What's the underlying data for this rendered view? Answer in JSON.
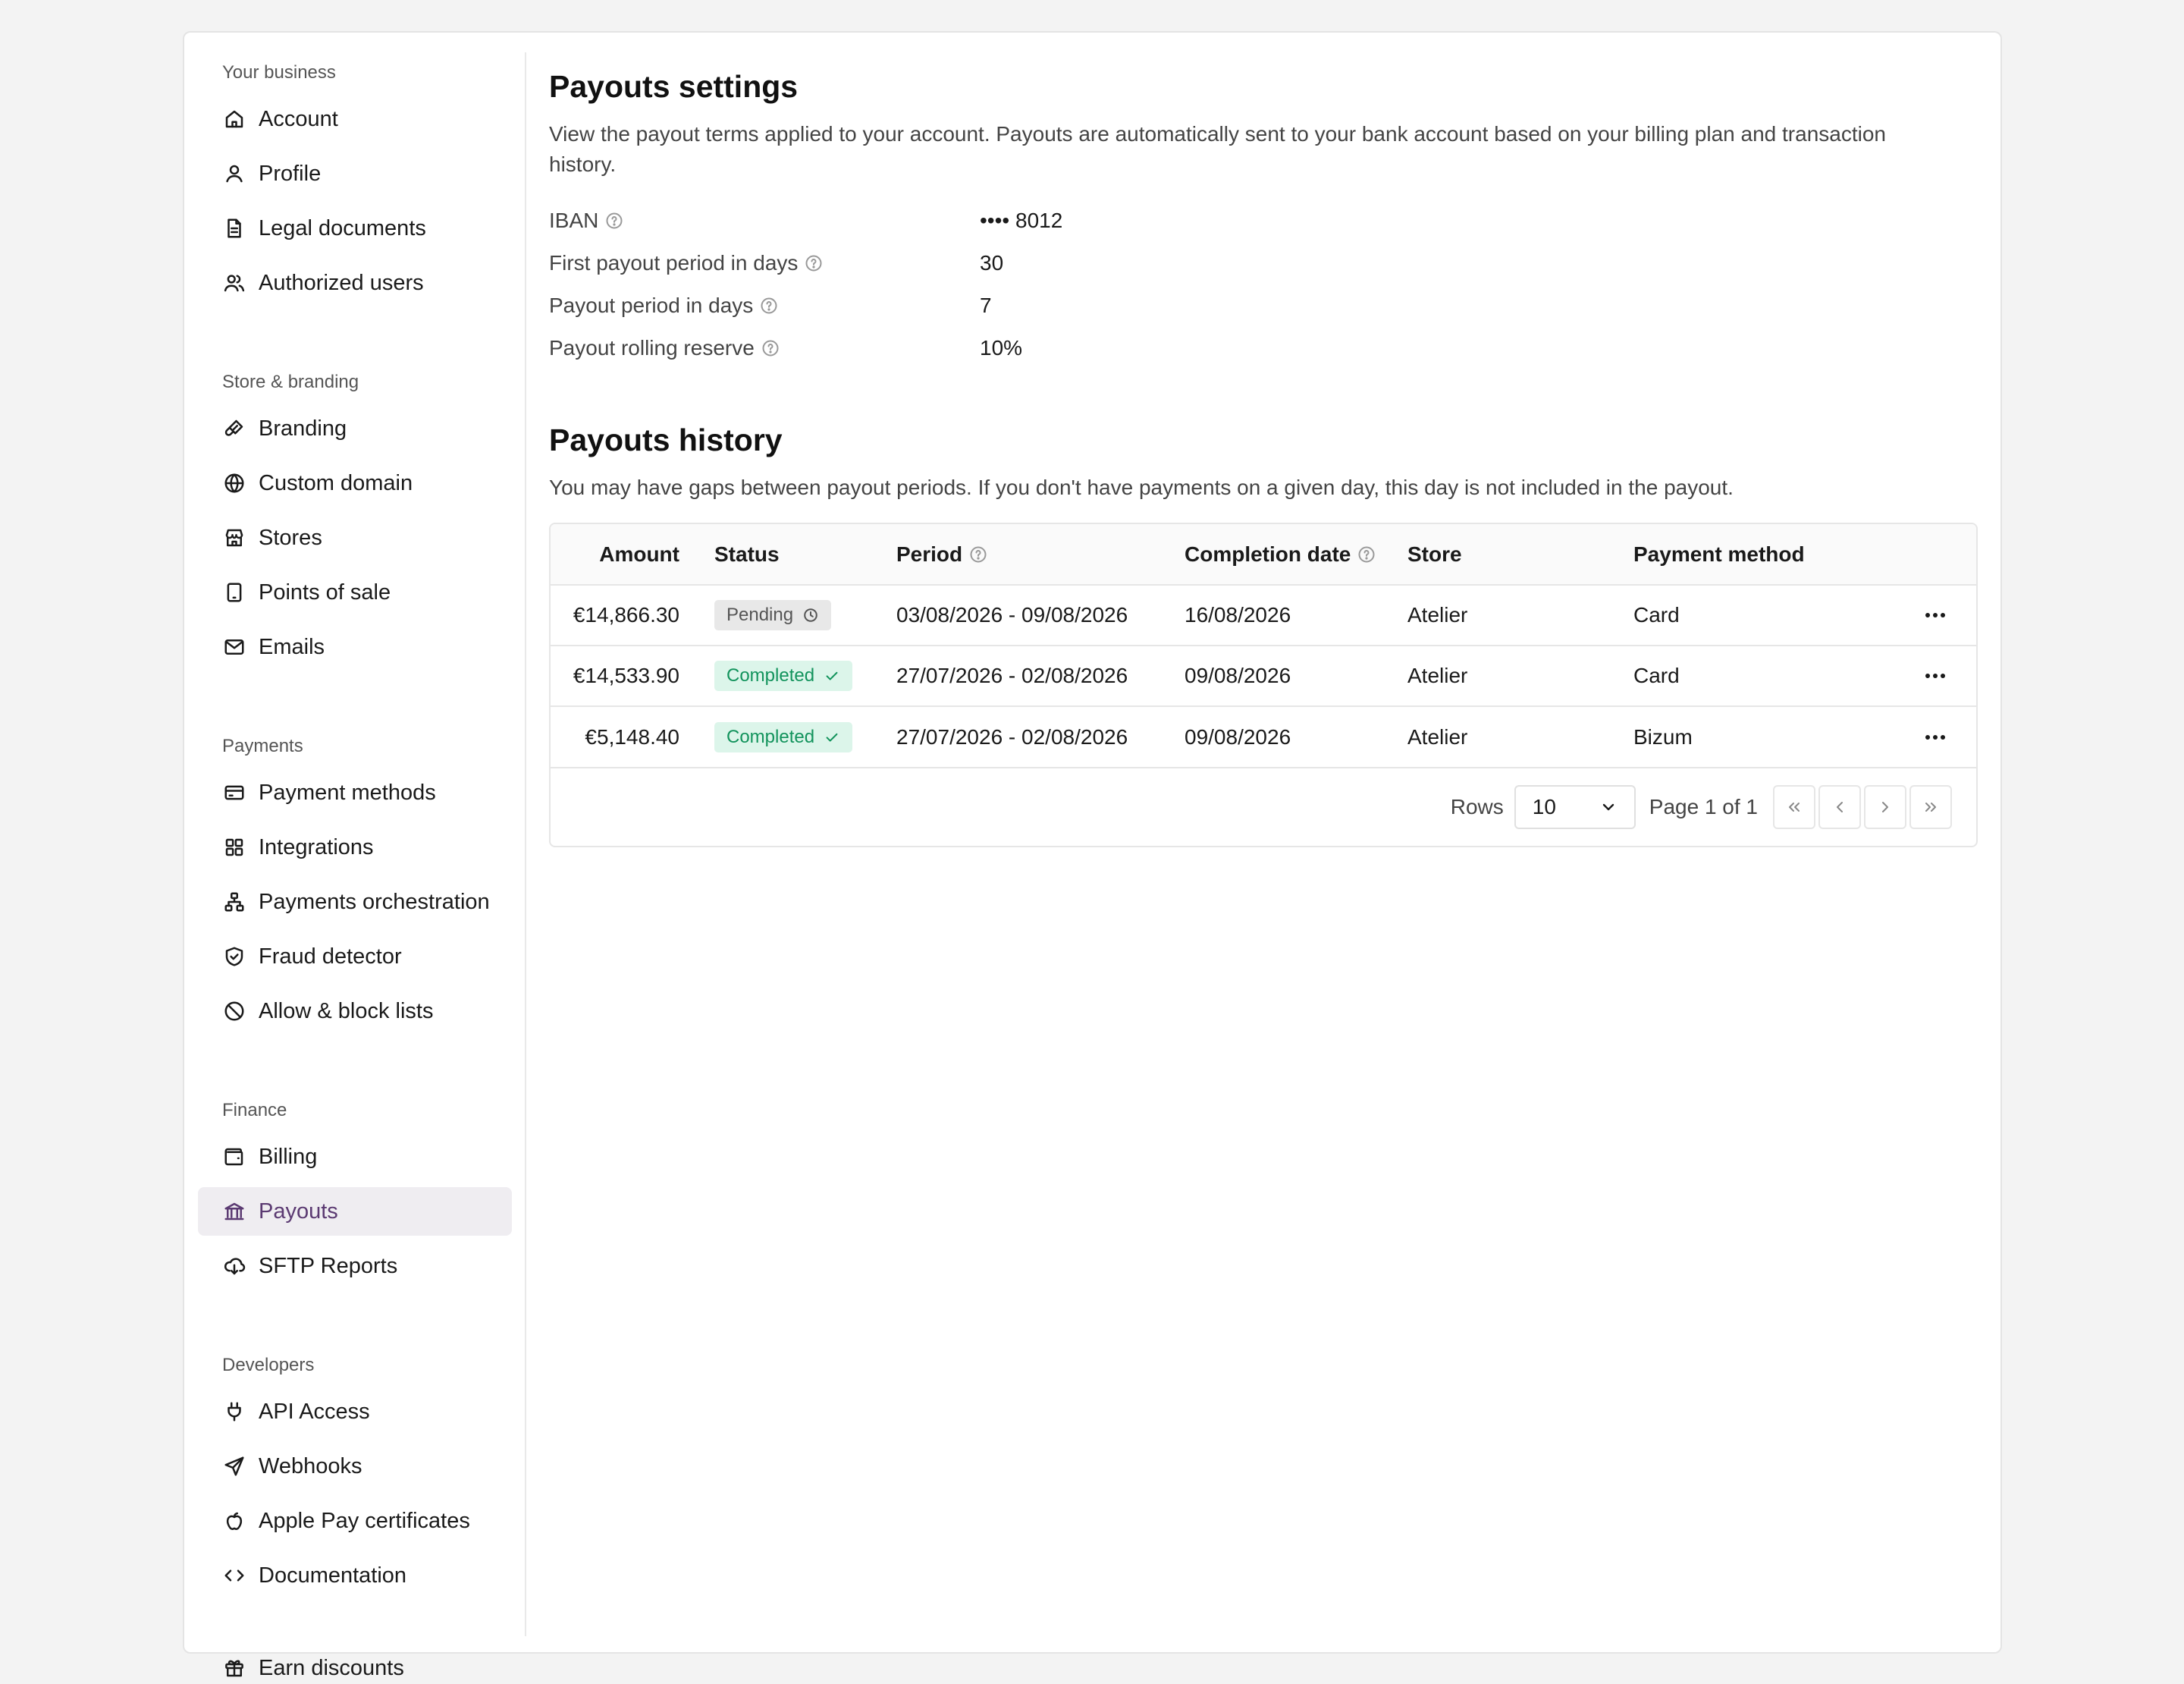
{
  "sidebar": {
    "sections": [
      {
        "title": "Your business",
        "items": [
          {
            "label": "Account",
            "icon": "home-icon"
          },
          {
            "label": "Profile",
            "icon": "user-icon"
          },
          {
            "label": "Legal documents",
            "icon": "document-icon"
          },
          {
            "label": "Authorized users",
            "icon": "users-icon"
          }
        ]
      },
      {
        "title": "Store & branding",
        "items": [
          {
            "label": "Branding",
            "icon": "brush-icon"
          },
          {
            "label": "Custom domain",
            "icon": "globe-icon"
          },
          {
            "label": "Stores",
            "icon": "store-icon"
          },
          {
            "label": "Points of sale",
            "icon": "tablet-icon"
          },
          {
            "label": "Emails",
            "icon": "mail-icon"
          }
        ]
      },
      {
        "title": "Payments",
        "items": [
          {
            "label": "Payment methods",
            "icon": "credit-card-icon"
          },
          {
            "label": "Integrations",
            "icon": "grid-icon"
          },
          {
            "label": "Payments orchestration",
            "icon": "network-icon"
          },
          {
            "label": "Fraud detector",
            "icon": "shield-check-icon"
          },
          {
            "label": "Allow & block lists",
            "icon": "ban-icon"
          }
        ]
      },
      {
        "title": "Finance",
        "items": [
          {
            "label": "Billing",
            "icon": "wallet-icon"
          },
          {
            "label": "Payouts",
            "icon": "bank-icon",
            "active": true
          },
          {
            "label": "SFTP Reports",
            "icon": "cloud-download-icon"
          }
        ]
      },
      {
        "title": "Developers",
        "items": [
          {
            "label": "API Access",
            "icon": "plug-icon"
          },
          {
            "label": "Webhooks",
            "icon": "send-icon"
          },
          {
            "label": "Apple Pay certificates",
            "icon": "apple-icon"
          },
          {
            "label": "Documentation",
            "icon": "code-icon"
          }
        ]
      }
    ],
    "footer_item": {
      "label": "Earn discounts",
      "icon": "gift-icon"
    }
  },
  "settings": {
    "title": "Payouts settings",
    "description": "View the payout terms applied to your account. Payouts are automatically sent to your bank account based on your billing plan and transaction history.",
    "terms": [
      {
        "label": "IBAN",
        "value": "•••• 8012"
      },
      {
        "label": "First payout period in days",
        "value": "30"
      },
      {
        "label": "Payout period in days",
        "value": "7"
      },
      {
        "label": "Payout rolling reserve",
        "value": "10%"
      }
    ]
  },
  "history": {
    "title": "Payouts history",
    "description": "You may have gaps between payout periods. If you don't have payments on a given day, this day is not included in the payout.",
    "columns": {
      "amount": "Amount",
      "status": "Status",
      "period": "Period",
      "completion": "Completion date",
      "store": "Store",
      "method": "Payment method"
    },
    "rows": [
      {
        "amount": "€14,866.30",
        "status": "Pending",
        "status_type": "pending",
        "period": "03/08/2026 - 09/08/2026",
        "completion": "16/08/2026",
        "store": "Atelier",
        "method": "Card"
      },
      {
        "amount": "€14,533.90",
        "status": "Completed",
        "status_type": "completed",
        "period": "27/07/2026 - 02/08/2026",
        "completion": "09/08/2026",
        "store": "Atelier",
        "method": "Card"
      },
      {
        "amount": "€5,148.40",
        "status": "Completed",
        "status_type": "completed",
        "period": "27/07/2026 - 02/08/2026",
        "completion": "09/08/2026",
        "store": "Atelier",
        "method": "Bizum"
      }
    ],
    "pagination": {
      "rows_label": "Rows",
      "rows_value": "10",
      "page_info": "Page 1 of 1"
    }
  },
  "colors": {
    "active_nav_bg": "#efedf1",
    "active_nav_text": "#5b3a72",
    "completed_bg": "#dcf5ea",
    "completed_text": "#12935c",
    "pending_bg": "#e8e8e8"
  }
}
